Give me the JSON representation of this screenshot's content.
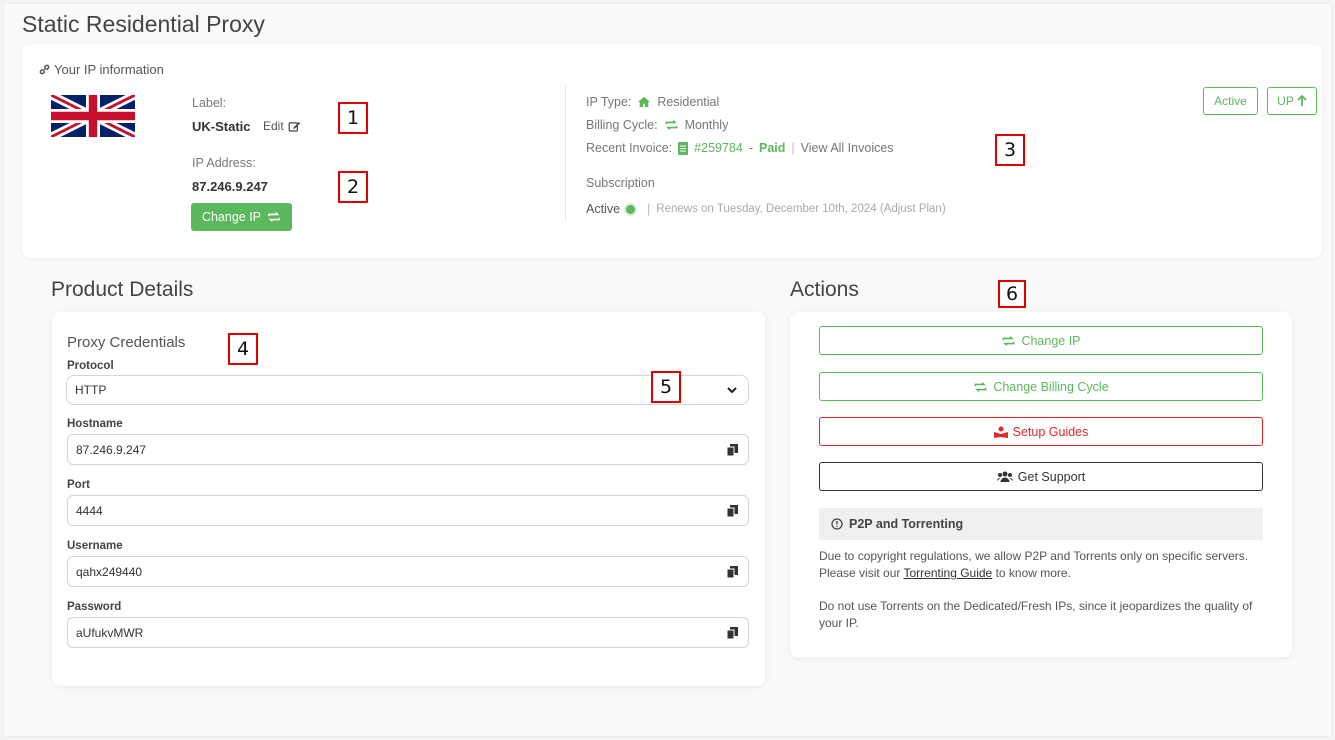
{
  "page": {
    "title": "Static Residential Proxy"
  },
  "ip_info": {
    "header": "Your IP information",
    "flag": "uk-flag",
    "label_caption": "Label:",
    "label_value": "UK-Static",
    "edit_label": "Edit",
    "ip_caption": "IP Address:",
    "ip_value": "87.246.9.247",
    "change_ip_button": "Change IP",
    "ip_type_caption": "IP Type:",
    "ip_type_value": "Residential",
    "billing_caption": "Billing Cycle:",
    "billing_value": "Monthly",
    "invoice_caption": "Recent Invoice:",
    "invoice_number": "#259784",
    "invoice_dash": "-",
    "invoice_status": "Paid",
    "invoice_sep": "|",
    "view_all_invoices": "View All Invoices",
    "subscription_caption": "Subscription",
    "subscription_status": "Active",
    "renew_sep": "|",
    "renews_text": "Renews on Tuesday, December 10th, 2024 (Adjust Plan)",
    "status_badge": "Active",
    "up_badge": "UP"
  },
  "product_details": {
    "title": "Product Details",
    "credentials_title": "Proxy Credentials",
    "protocol_label": "Protocol",
    "protocol_value": "HTTP",
    "hostname_label": "Hostname",
    "hostname_value": "87.246.9.247",
    "port_label": "Port",
    "port_value": "4444",
    "username_label": "Username",
    "username_value": "qahx249440",
    "password_label": "Password",
    "password_value": "aUfukvMWR"
  },
  "actions": {
    "title": "Actions",
    "change_ip": "Change IP",
    "change_billing": "Change Billing Cycle",
    "setup_guides": "Setup Guides",
    "get_support": "Get Support",
    "p2p_title": "P2P and Torrenting",
    "p2p_text1": "Due to copyright regulations, we allow P2P and Torrents only on specific servers.",
    "p2p_text2_pre": "Please visit our",
    "p2p_link": "Torrenting Guide",
    "p2p_text2_post": "to know more.",
    "p2p_text3": "Do not use Torrents on the Dedicated/Fresh IPs, since it jeopardizes the quality of your IP."
  },
  "markers": [
    "1",
    "2",
    "3",
    "4",
    "5",
    "6"
  ],
  "colors": {
    "accent": "#5cb85c",
    "danger": "#e02a2a",
    "marker": "#e00000"
  }
}
